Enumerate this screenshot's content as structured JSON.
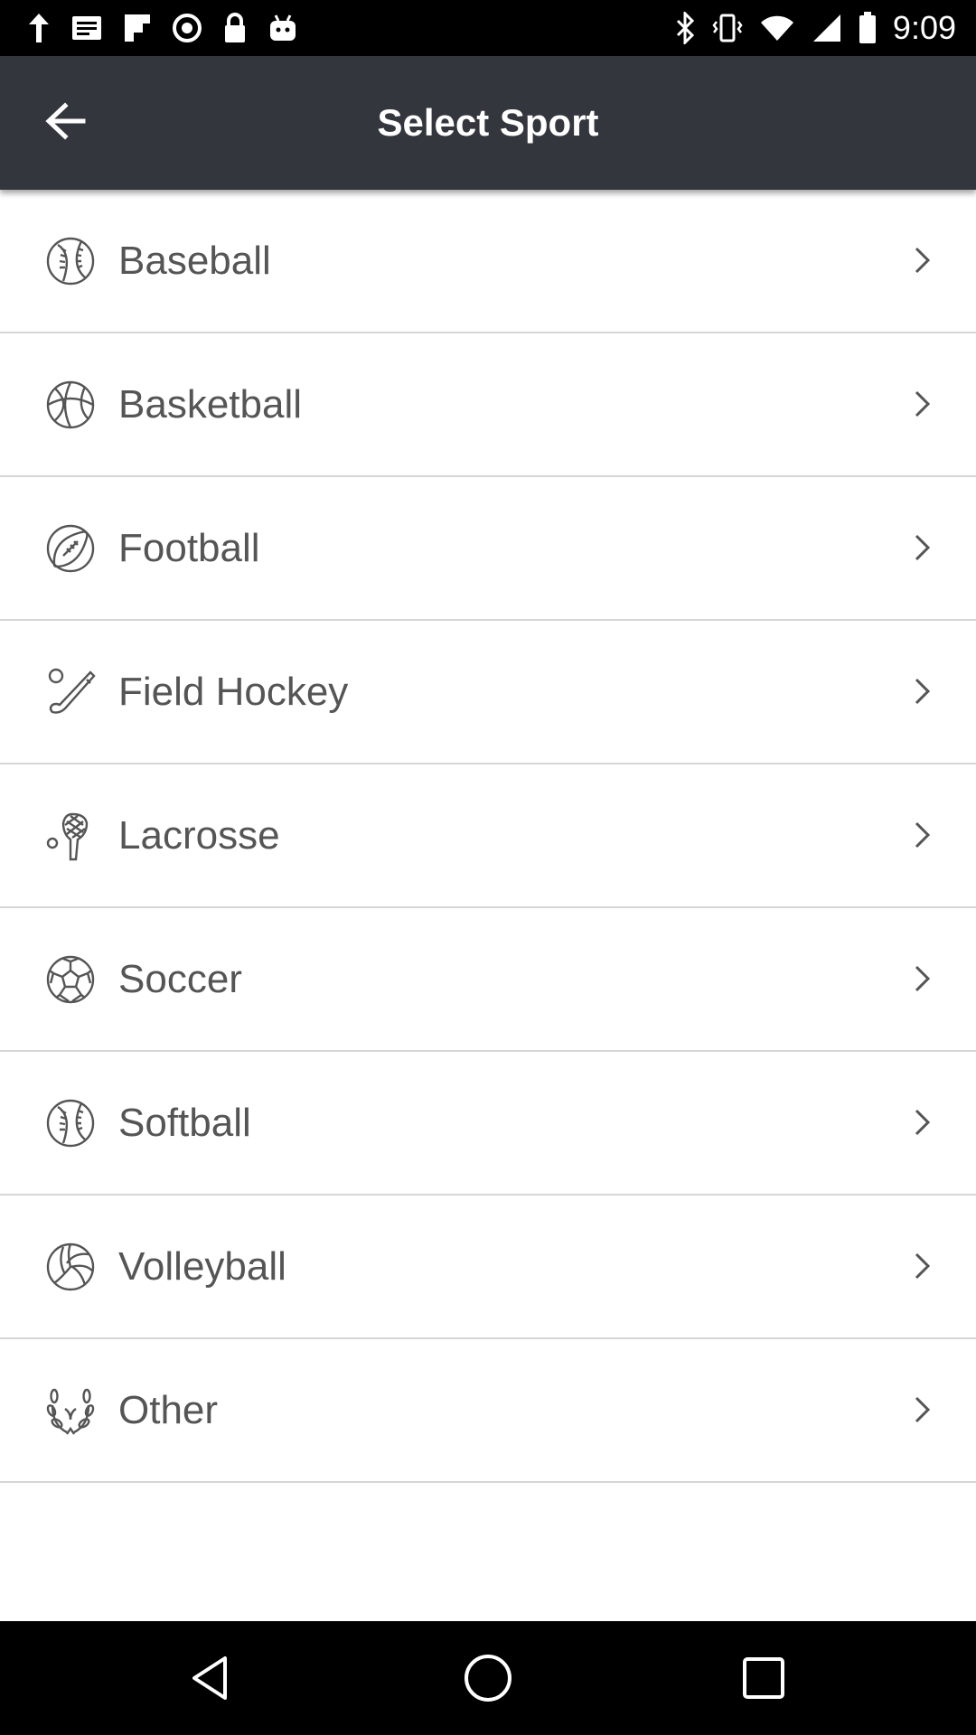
{
  "status_bar": {
    "time": "9:09",
    "left_icons": [
      "navigation-arrow-icon",
      "message-icon",
      "flipboard-icon",
      "sync-icon",
      "lock-icon",
      "android-icon"
    ],
    "right_icons": [
      "bluetooth-icon",
      "vibrate-icon",
      "wifi-icon",
      "signal-icon",
      "battery-icon"
    ]
  },
  "app_bar": {
    "title": "Select Sport",
    "back_icon": "arrow-left-icon",
    "background": "#33363d"
  },
  "sports": [
    {
      "label": "Baseball",
      "icon": "baseball-icon"
    },
    {
      "label": "Basketball",
      "icon": "basketball-icon"
    },
    {
      "label": "Football",
      "icon": "football-icon"
    },
    {
      "label": "Field Hockey",
      "icon": "field-hockey-icon"
    },
    {
      "label": "Lacrosse",
      "icon": "lacrosse-icon"
    },
    {
      "label": "Soccer",
      "icon": "soccer-icon"
    },
    {
      "label": "Softball",
      "icon": "softball-icon"
    },
    {
      "label": "Volleyball",
      "icon": "volleyball-icon"
    },
    {
      "label": "Other",
      "icon": "laurel-icon"
    }
  ],
  "nav_bar": {
    "buttons": [
      "back-triangle-icon",
      "home-circle-icon",
      "recents-square-icon"
    ]
  },
  "colors": {
    "label_text": "#555555",
    "divider": "#d6d6d6",
    "icon_stroke": "#555555"
  }
}
